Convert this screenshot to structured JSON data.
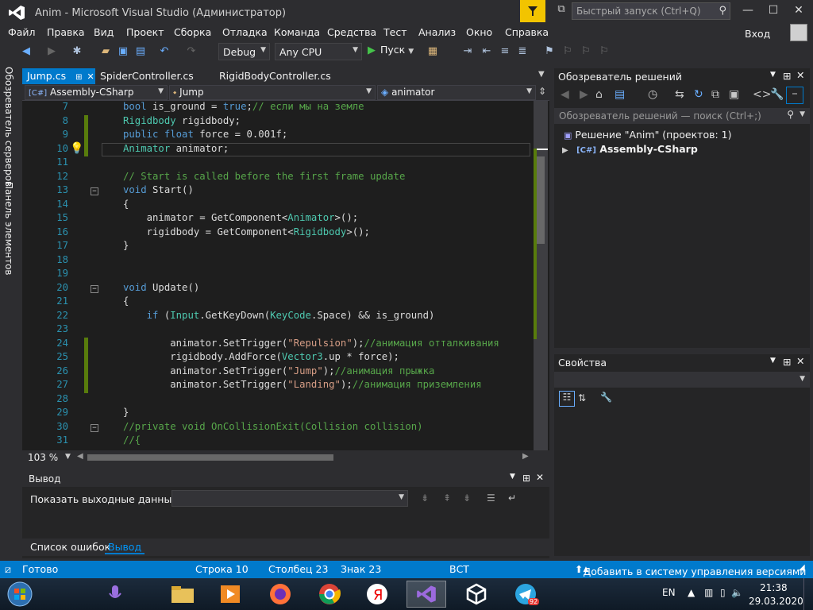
{
  "window": {
    "title": "Anim - Microsoft Visual Studio  (Администратор)",
    "quick_launch_placeholder": "Быстрый запуск (Ctrl+Q)"
  },
  "menu": {
    "items": [
      "Файл",
      "Правка",
      "Вид",
      "Проект",
      "Сборка",
      "Отладка",
      "Команда",
      "Средства",
      "Тест",
      "Анализ",
      "Окно",
      "Справка"
    ],
    "login": "Вход"
  },
  "toolbar": {
    "configuration": "Debug",
    "platform": "Any CPU",
    "run_label": "Пуск"
  },
  "left_tabs": {
    "server_explorer": "Обозреватель серверов",
    "toolbox": "Панель элементов"
  },
  "doc_tabs": [
    {
      "label": "Jump.cs",
      "active": true
    },
    {
      "label": "SpiderController.cs",
      "active": false
    },
    {
      "label": "RigidBodyController.cs",
      "active": false
    }
  ],
  "nav_bar": {
    "project": "Assembly-CSharp",
    "class": "Jump",
    "member": "animator"
  },
  "editor": {
    "zoom": "103 %",
    "current_line": 10,
    "lines": [
      {
        "n": "7",
        "code": "bool is_ground = true;// если мы на земле"
      },
      {
        "n": "8",
        "code": "Rigidbody rigidbody;"
      },
      {
        "n": "9",
        "code": "public float force = 0.001f;"
      },
      {
        "n": "10",
        "code": "Animator animator;"
      },
      {
        "n": "11",
        "code": ""
      },
      {
        "n": "12",
        "code": "// Start is called before the first frame update"
      },
      {
        "n": "13",
        "code": "void Start()"
      },
      {
        "n": "14",
        "code": "{"
      },
      {
        "n": "15",
        "code": "    animator = GetComponent<Animator>();"
      },
      {
        "n": "16",
        "code": "    rigidbody = GetComponent<Rigidbody>();"
      },
      {
        "n": "17",
        "code": "}"
      },
      {
        "n": "18",
        "code": ""
      },
      {
        "n": "19",
        "code": ""
      },
      {
        "n": "20",
        "code": "void Update()"
      },
      {
        "n": "21",
        "code": "{"
      },
      {
        "n": "22",
        "code": "    if (Input.GetKeyDown(KeyCode.Space) && is_ground)"
      },
      {
        "n": "23",
        "code": ""
      },
      {
        "n": "24",
        "code": "        animator.SetTrigger(\"Repulsion\");//анимация отталкивания"
      },
      {
        "n": "25",
        "code": "        rigidbody.AddForce(Vector3.up * force);"
      },
      {
        "n": "26",
        "code": "        animator.SetTrigger(\"Jump\");//анимация прыжка"
      },
      {
        "n": "27",
        "code": "        animator.SetTrigger(\"Landing\");//анимация приземления"
      },
      {
        "n": "28",
        "code": ""
      },
      {
        "n": "29",
        "code": "}"
      },
      {
        "n": "30",
        "code": "//private void OnCollisionExit(Collision collision)"
      },
      {
        "n": "31",
        "code": "//{"
      }
    ]
  },
  "output": {
    "title": "Вывод",
    "show_from_label": "Показать выходные данные из:"
  },
  "bottom_tabs": [
    "Список ошибок",
    "Вывод"
  ],
  "solution_explorer": {
    "title": "Обозреватель решений",
    "search_placeholder": "Обозреватель решений — поиск (Ctrl+;)",
    "solution": "Решение \"Anim\"  (проектов: 1)",
    "project": "Assembly-CSharp"
  },
  "properties": {
    "title": "Свойства"
  },
  "status": {
    "ready": "Готово",
    "line": "Строка 10",
    "column": "Столбец 23",
    "char": "Знак 23",
    "mode": "ВСТ",
    "source_control": "Добавить в систему управления версиями"
  },
  "taskbar": {
    "lang": "EN",
    "time": "21:38",
    "date": "29.03.2020",
    "telegram_badge": "92"
  }
}
